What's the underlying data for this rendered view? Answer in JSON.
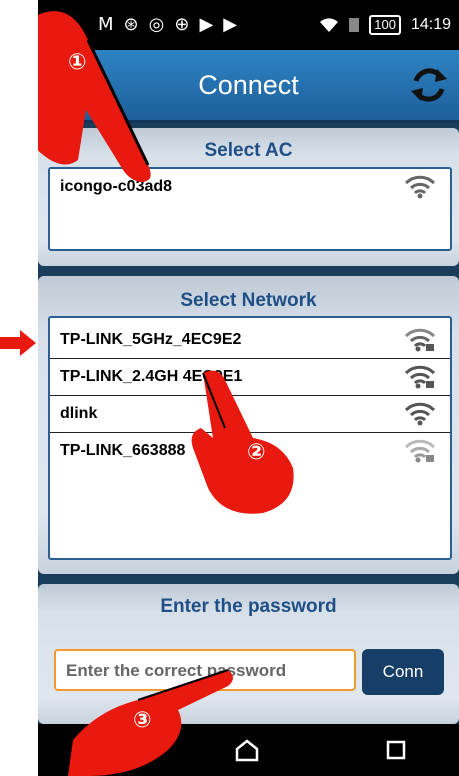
{
  "status_bar": {
    "icons": [
      "M",
      "⊛",
      "◎",
      "⊕",
      "▶",
      "▶"
    ],
    "battery": "100",
    "time": "14:19"
  },
  "app_bar": {
    "title": "Connect",
    "refresh_icon": "refresh-icon"
  },
  "select_ac": {
    "title": "Select AC",
    "items": [
      {
        "label": "icongo-c03ad8",
        "secured": false
      }
    ]
  },
  "select_network": {
    "title": "Select Network",
    "items": [
      {
        "label": "TP-LINK_5GHz_4EC9E2",
        "secured": true
      },
      {
        "label": "TP-LINK_2.4GH  4EC9E1",
        "secured": true
      },
      {
        "label": "dlink",
        "secured": false
      },
      {
        "label": "TP-LINK_663888",
        "secured": true
      }
    ]
  },
  "password": {
    "title": "Enter the password",
    "placeholder": "Enter the correct password",
    "button_label": "Conn"
  },
  "annotations": {
    "step1": "①",
    "step2": "②",
    "step3": "③"
  },
  "colors": {
    "accent": "#2e83c4",
    "card_title": "#1f4f86",
    "input_border": "#f29b2c",
    "hand": "#e8190f"
  }
}
